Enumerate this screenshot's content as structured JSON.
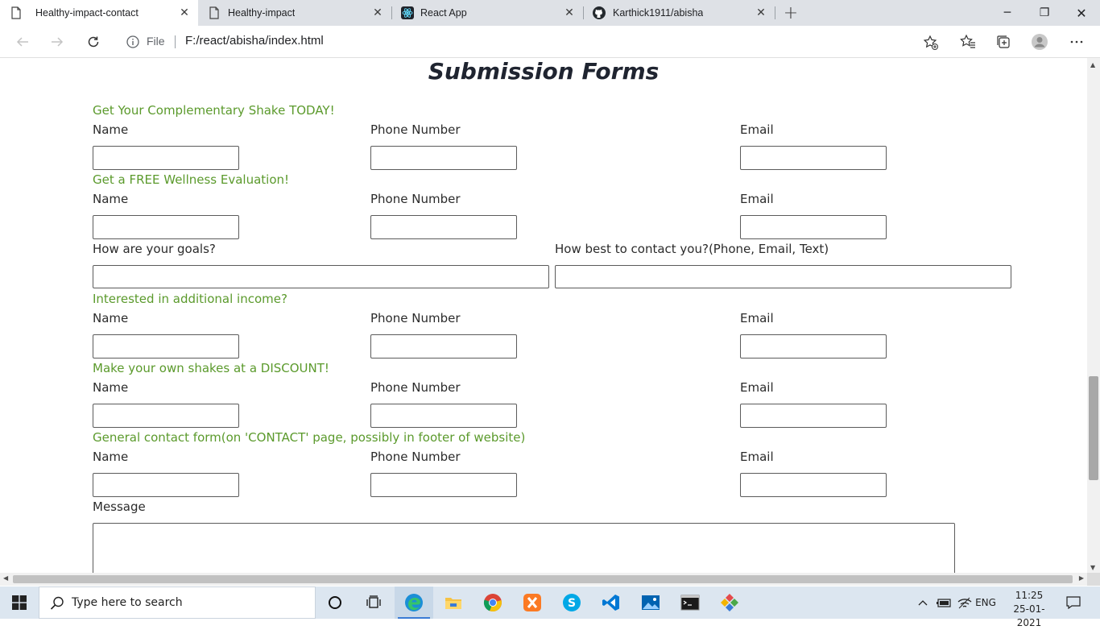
{
  "browser": {
    "tabs": [
      {
        "title": "Healthy-impact-contact",
        "active": true,
        "icon": "page-icon"
      },
      {
        "title": "Healthy-impact",
        "active": false,
        "icon": "page-icon"
      },
      {
        "title": "React App",
        "active": false,
        "icon": "react-icon"
      },
      {
        "title": "Karthick1911/abisha",
        "active": false,
        "icon": "github-icon"
      }
    ],
    "close_glyph": "✕",
    "new_tab_glyph": "+",
    "window_controls": {
      "minimize": "─",
      "maximize": "❐",
      "close": "✕"
    },
    "address": {
      "scheme_label": "File",
      "url": "F:/react/abisha/index.html"
    }
  },
  "page": {
    "title": "Submission Forms",
    "sections": [
      {
        "heading": "Get Your Complementary Shake TODAY!",
        "labels": {
          "name": "Name",
          "phone": "Phone Number",
          "email": "Email"
        }
      },
      {
        "heading": "Get a FREE Wellness Evaluation!",
        "labels": {
          "name": "Name",
          "phone": "Phone Number",
          "email": "Email"
        },
        "extra": {
          "goals": "How are your goals?",
          "contact_pref": "How best to contact you?(Phone, Email, Text)"
        }
      },
      {
        "heading": "Interested in additional income?",
        "labels": {
          "name": "Name",
          "phone": "Phone Number",
          "email": "Email"
        }
      },
      {
        "heading": "Make your own shakes at a DISCOUNT!",
        "labels": {
          "name": "Name",
          "phone": "Phone Number",
          "email": "Email"
        }
      },
      {
        "heading": "General contact form(on 'CONTACT' page, possibly in footer of website)",
        "labels": {
          "name": "Name",
          "phone": "Phone Number",
          "email": "Email"
        },
        "extra": {
          "message": "Message"
        }
      }
    ],
    "colors": {
      "heading": "#5b9a2c",
      "title": "#1f2430"
    }
  },
  "taskbar": {
    "search_placeholder": "Type here to search",
    "apps": [
      "cortana-icon",
      "task-view-icon",
      "edge-icon",
      "file-explorer-icon",
      "chrome-icon",
      "xampp-icon",
      "skype-icon",
      "vscode-icon",
      "photos-icon",
      "cmd-icon",
      "git-icon"
    ],
    "tray": {
      "language": "ENG",
      "time": "11:25",
      "date": "25-01-2021"
    }
  }
}
